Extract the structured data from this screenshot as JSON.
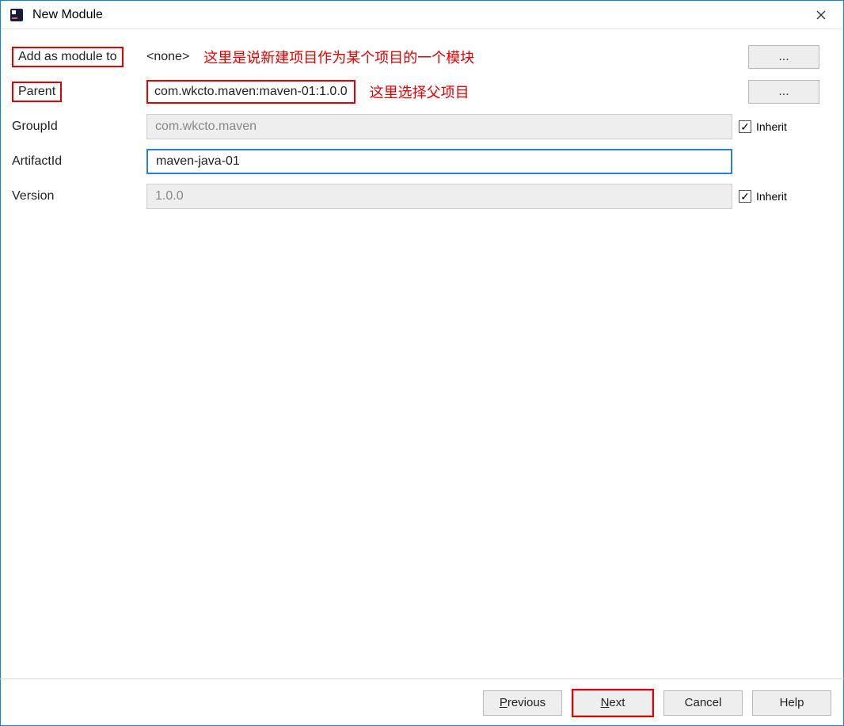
{
  "window": {
    "title": "New Module"
  },
  "form": {
    "add_as_module_label": "Add as module to",
    "add_as_module_value": "<none>",
    "parent_label": "Parent",
    "parent_value": "com.wkcto.maven:maven-01:1.0.0",
    "groupid_label": "GroupId",
    "groupid_value": "com.wkcto.maven",
    "artifactid_label": "ArtifactId",
    "artifactid_value": "maven-java-01",
    "version_label": "Version",
    "version_value": "1.0.0",
    "inherit_label": "Inherit",
    "browse_label": "...",
    "groupid_inherit_checked": true,
    "version_inherit_checked": true
  },
  "annotations": {
    "add_as_module": "这里是说新建项目作为某个项目的一个模块",
    "parent": "这里选择父项目"
  },
  "footer": {
    "previous": "Previous",
    "next": "Next",
    "cancel": "Cancel",
    "help": "Help"
  }
}
